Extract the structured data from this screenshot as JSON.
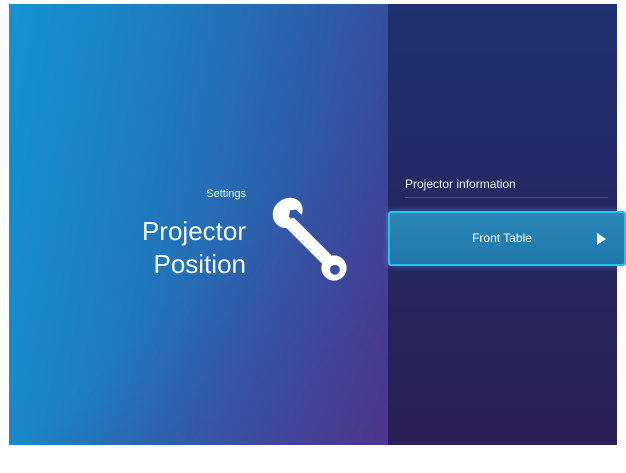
{
  "header": {
    "category": "Settings",
    "title_line1": "Projector",
    "title_line2": "Position",
    "icon": "wrench-icon"
  },
  "panel": {
    "section_label": "Projector information",
    "selected_option": {
      "label": "Front Table",
      "icon": "play-arrow-icon"
    }
  },
  "colors": {
    "left_gradient_start": "#1493d2",
    "left_gradient_end": "#3d3f8f",
    "right_panel": "#252760",
    "highlight_border": "#27c2e6",
    "highlight_fill": "#2a86b9"
  }
}
